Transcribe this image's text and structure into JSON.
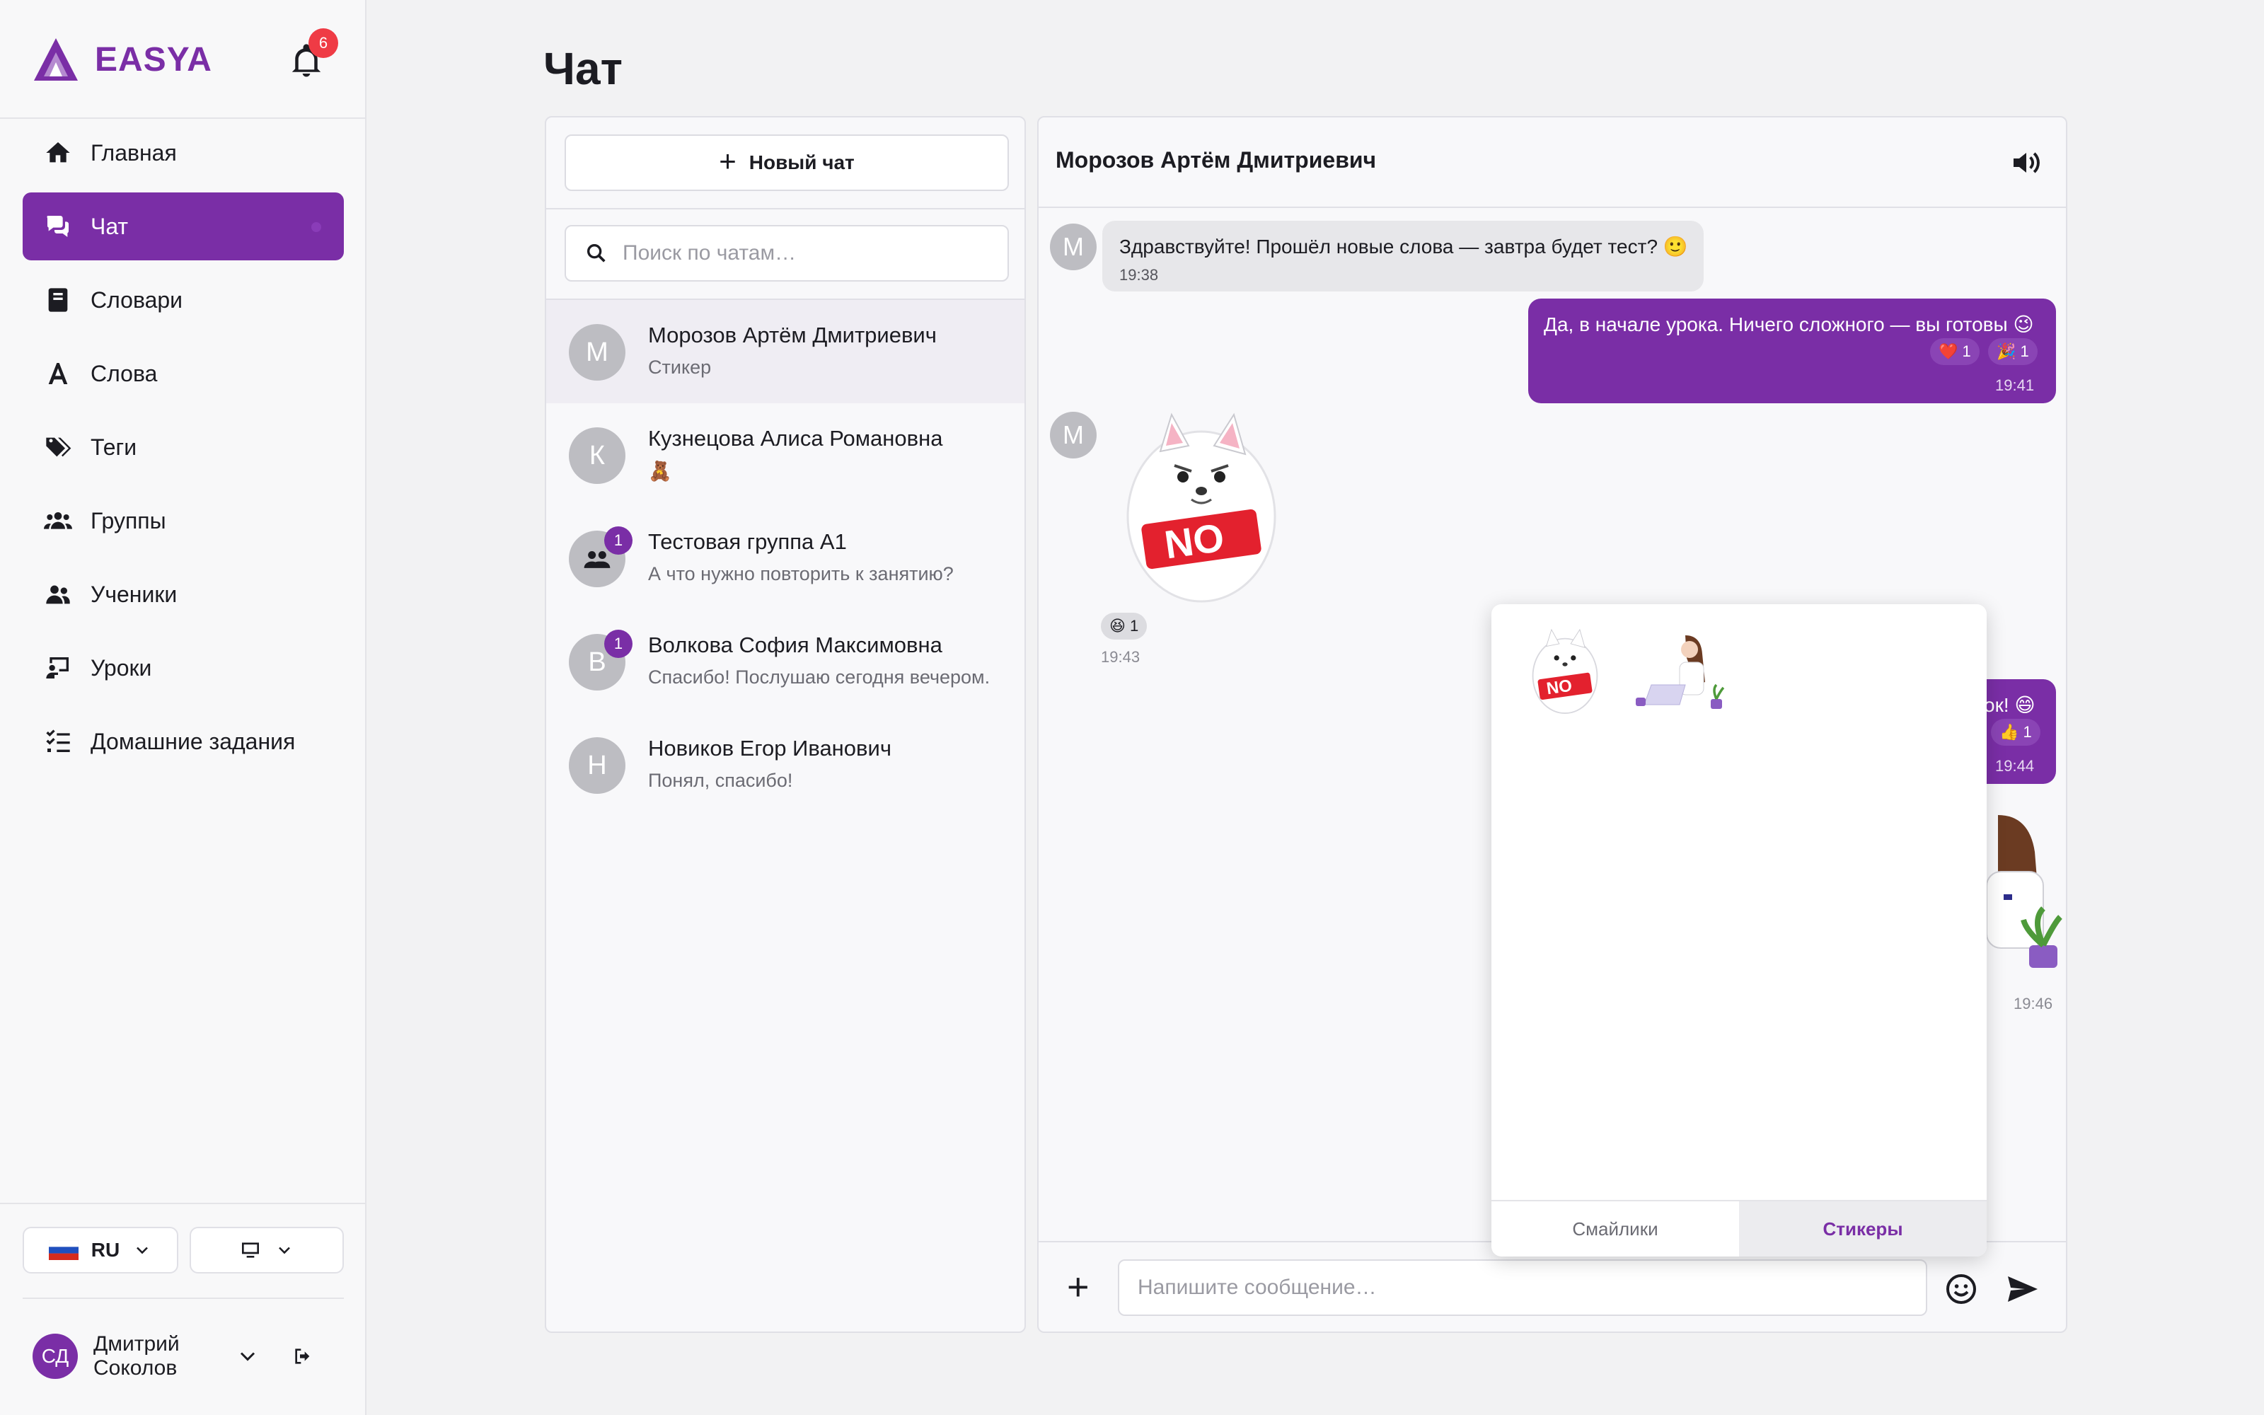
{
  "brand": {
    "name": "EASYA",
    "notifications": "6"
  },
  "nav": [
    {
      "label": "Главная",
      "icon": "home-icon"
    },
    {
      "label": "Чат",
      "icon": "chat-icon",
      "active": true
    },
    {
      "label": "Словари",
      "icon": "book-icon"
    },
    {
      "label": "Слова",
      "icon": "letter-icon"
    },
    {
      "label": "Теги",
      "icon": "tags-icon"
    },
    {
      "label": "Группы",
      "icon": "group-icon"
    },
    {
      "label": "Ученики",
      "icon": "students-icon"
    },
    {
      "label": "Уроки",
      "icon": "lesson-icon"
    },
    {
      "label": "Домашние задания",
      "icon": "tasks-icon"
    }
  ],
  "footer": {
    "language": "RU",
    "user_initials": "СД",
    "user_name": "Дмитрий Соколов"
  },
  "page": {
    "title": "Чат"
  },
  "chatlist": {
    "new_chat": "Новый чат",
    "search_placeholder": "Поиск по чатам…",
    "conversations": [
      {
        "initial": "М",
        "name": "Морозов Артём Дмитриевич",
        "last": "Стикер",
        "badge": ""
      },
      {
        "initial": "К",
        "name": "Кузнецова Алиса Романовна",
        "last": "🧸",
        "badge": ""
      },
      {
        "initial": "",
        "name": "Тестовая группа A1",
        "last": "А что нужно повторить к занятию?",
        "badge": "1"
      },
      {
        "initial": "В",
        "name": "Волкова София Максимовна",
        "last": "Спасибо! Послушаю сегодня вечером.",
        "badge": "1"
      },
      {
        "initial": "Н",
        "name": "Новиков Егор Иванович",
        "last": "Понял, спасибо!",
        "badge": ""
      }
    ]
  },
  "chat": {
    "title": "Морозов Артём Дмитриевич",
    "messages": [
      {
        "author_initial": "М",
        "text": "Здравствуйте! Прошёл новые слова — завтра будет тест? 🙂",
        "time": "19:38"
      },
      {
        "text": "Да, в начале урока. Ничего сложного — вы готовы 😉",
        "time": "19:41",
        "reactions": [
          "❤️ 1",
          "🎉 1"
        ]
      },
      {
        "author_initial": "М",
        "sticker": "NO",
        "time": "19:43",
        "reactions": [
          "😆 1"
        ]
      },
      {
        "text_partial": "ок! 😄",
        "time": "19:44",
        "reactions": [
          "👍 1"
        ]
      },
      {
        "sticker": "girl-laptop",
        "time": "19:46"
      }
    ],
    "composer_placeholder": "Напишите сообщение…"
  },
  "popup": {
    "tabs": [
      "Смайлики",
      "Стикеры"
    ],
    "sticker_label": "NO"
  }
}
